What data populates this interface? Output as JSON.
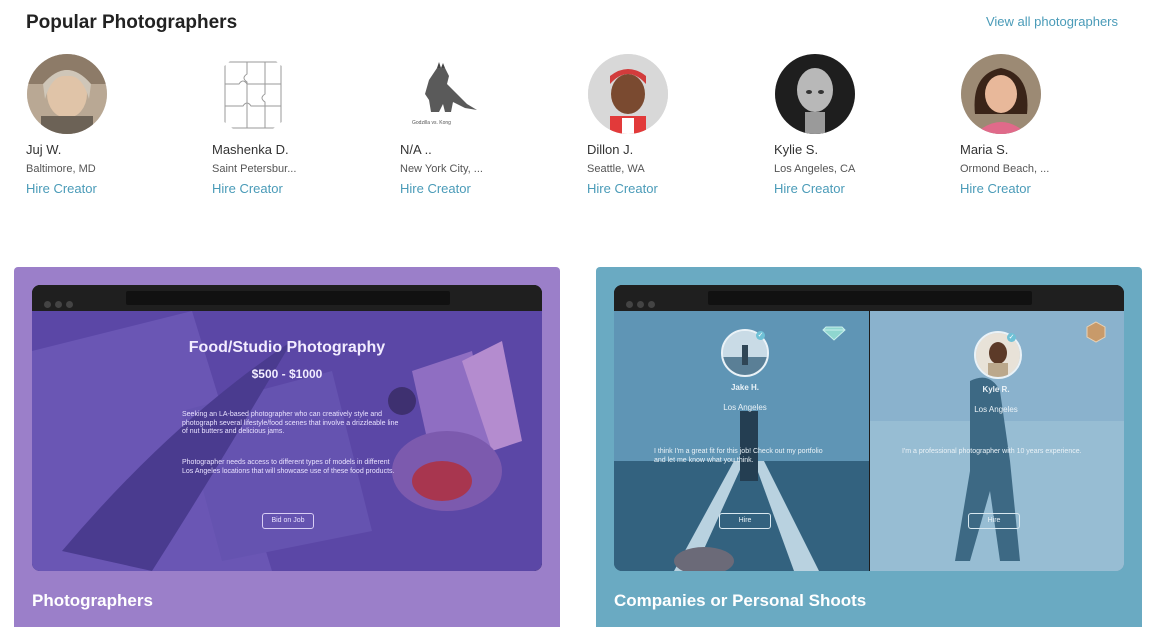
{
  "header": {
    "title": "Popular Photographers",
    "view_all": "View all photographers"
  },
  "photographers": [
    {
      "name": "Juj W.",
      "location": "Baltimore, MD",
      "cta": "Hire Creator"
    },
    {
      "name": "Mashenka D.",
      "location": "Saint Petersbur...",
      "cta": "Hire Creator"
    },
    {
      "name": "N/A ..",
      "location": "New York City, ...",
      "cta": "Hire Creator"
    },
    {
      "name": "Dillon J.",
      "location": "Seattle, WA",
      "cta": "Hire Creator"
    },
    {
      "name": "Kylie S.",
      "location": "Los Angeles, CA",
      "cta": "Hire Creator"
    },
    {
      "name": "Maria S.",
      "location": "Ormond Beach, ...",
      "cta": "Hire Creator"
    }
  ],
  "godzilla_caption": "Godzilla vs. Kong",
  "left_panel": {
    "label": "Photographers",
    "job": {
      "title": "Food/Studio Photography",
      "price": "$500 - $1000",
      "description_1": "Seeking an LA-based photographer who can creatively style and photograph several lifestyle/food scenes that involve a drizzleable line of nut butters and delicious jams.",
      "description_2": "Photographer needs access to different types of models in different Los Angeles locations that will showcase use of these food products.",
      "button": "Bid on Job"
    }
  },
  "right_panel": {
    "label": "Companies or Personal Shoots",
    "creators": [
      {
        "name": "Jake H.",
        "location": "Los Angeles",
        "message": "I think I'm a great fit for this job! Check out my portfolio and let me know what you think.",
        "button": "Hire"
      },
      {
        "name": "Kyle R.",
        "location": "Los Angeles",
        "message": "I'm a professional photographer with 10 years experience.",
        "button": "Hire"
      }
    ]
  },
  "colors": {
    "accent_link": "#4a9bb8",
    "left_panel_bg": "#9b7fc9",
    "right_panel_bg": "#6aaac2"
  },
  "icons": {
    "verified": "check-badge-icon",
    "tier_1": "diamond-icon",
    "tier_2": "hexagon-badge-icon"
  }
}
